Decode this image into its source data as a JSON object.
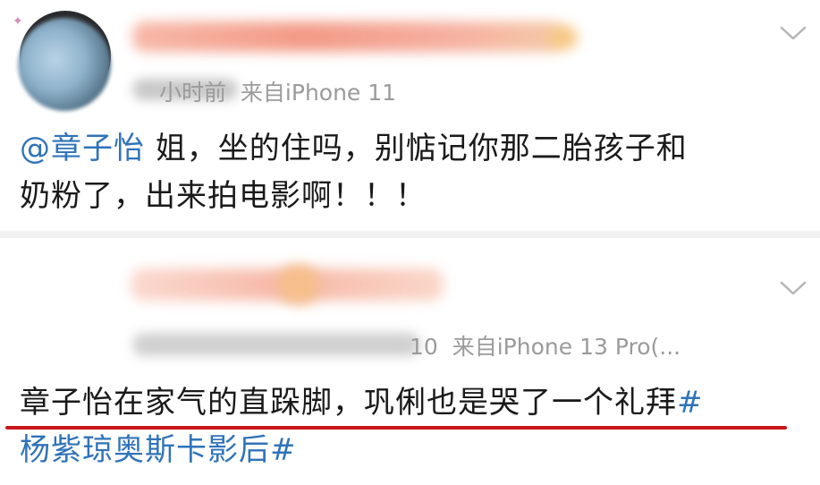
{
  "post1": {
    "time_partial": "小时前",
    "source": "来自iPhone 11",
    "mention": "@章子怡",
    "body_line1": "姐，坐的住吗，别惦记你那二胎孩子和",
    "body_line2": "奶粉了，出来拍电影啊！！！"
  },
  "post2": {
    "time_partial": "10",
    "source_partial": "来自",
    "source": "iPhone 13 Pro(...",
    "body_line1": "章子怡在家气的直跺脚，巩俐也是哭了一个礼拜",
    "hash_open": "#",
    "hashtag_line2": "杨紫琼奥斯卡影后#"
  },
  "colors": {
    "link_blue": "#2f73b9",
    "underline_red": "#c9161b",
    "meta_gray": "#9b9b9b"
  },
  "icons": [
    "chevron-down-icon",
    "avatar"
  ]
}
